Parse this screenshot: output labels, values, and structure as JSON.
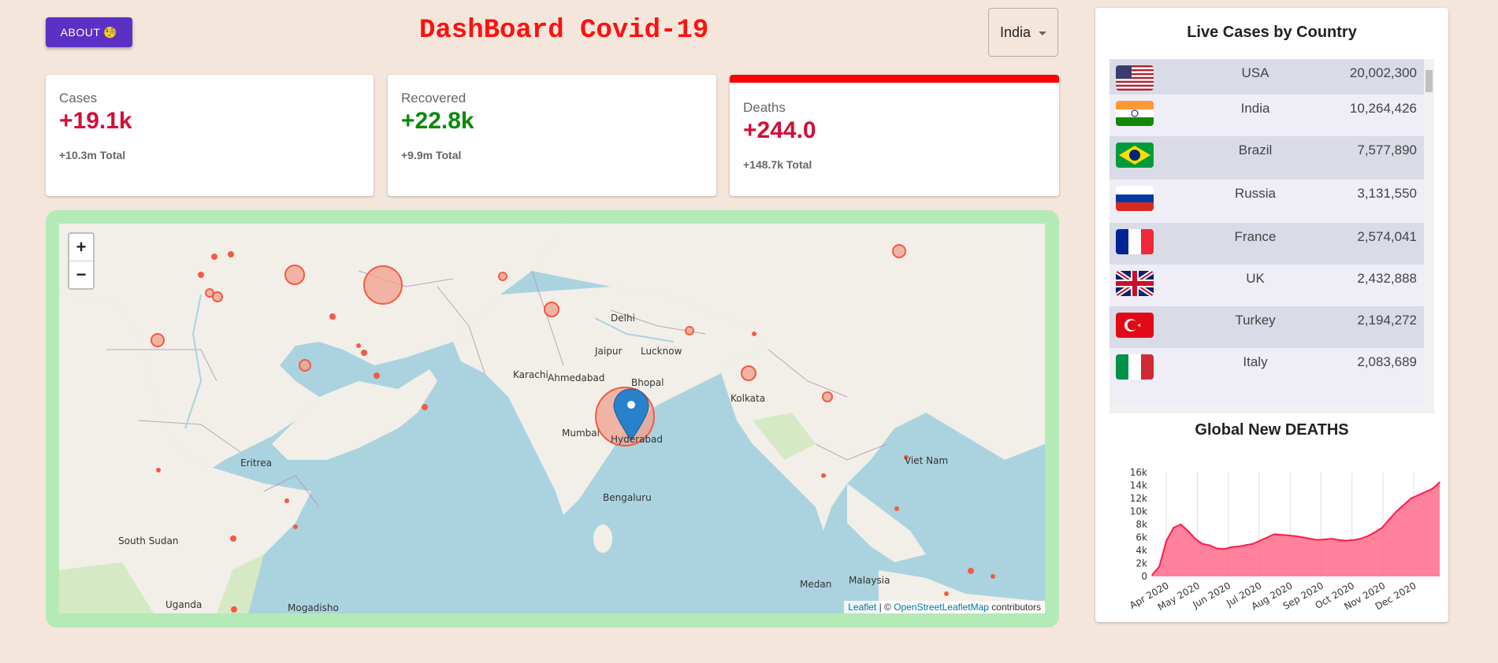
{
  "header": {
    "about_label": "ABOUT",
    "about_emoji": "🧐",
    "title": "DashBoard Covid-19",
    "selected_country": "India"
  },
  "cards": {
    "cases": {
      "label": "Cases",
      "value": "+19.1k",
      "total": "+10.3m Total",
      "color": "#d0103a"
    },
    "recovered": {
      "label": "Recovered",
      "value": "+22.8k",
      "total": "+9.9m Total",
      "color": "#0b8a0b"
    },
    "deaths": {
      "label": "Deaths",
      "value": "+244.0",
      "total": "+148.7k Total",
      "color": "#d0103a"
    }
  },
  "map": {
    "zoom_in": "+",
    "zoom_out": "−",
    "attribution_leaflet": "Leaflet",
    "attribution_sep": " | © ",
    "attribution_osm": "OpenStreetLeafletMap",
    "attribution_suffix": " contributors",
    "labels": [
      "Mumbai",
      "Hyderabad",
      "Bengaluru",
      "Ahmedabad",
      "Bhopal",
      "Jaipur",
      "Delhi",
      "Lucknow",
      "Kolkata",
      "Karachi",
      "Medan",
      "Malaysia",
      "Viet Nam",
      "Eritrea",
      "South Sudan",
      "Uganda",
      "Mogadisho"
    ]
  },
  "panel": {
    "live_title": "Live Cases by Country",
    "countries": [
      {
        "name": "USA",
        "count": "20,002,300",
        "flag": "us-flag"
      },
      {
        "name": "India",
        "count": "10,264,426",
        "flag": "in-flag"
      },
      {
        "name": "Brazil",
        "count": "7,577,890",
        "flag": "br-flag"
      },
      {
        "name": "Russia",
        "count": "3,131,550",
        "flag": "ru-flag"
      },
      {
        "name": "France",
        "count": "2,574,041",
        "flag": "fr-flag"
      },
      {
        "name": "UK",
        "count": "2,432,888",
        "flag": "uk-flag"
      },
      {
        "name": "Turkey",
        "count": "2,194,272",
        "flag": "tr-flag"
      },
      {
        "name": "Italy",
        "count": "2,083,689",
        "flag": "it-flag"
      }
    ],
    "chart_title": "Global New DEATHS"
  },
  "chart_data": {
    "type": "area",
    "title": "Global New DEATHS",
    "x": [
      "Mar 22",
      "Mar 29",
      "Apr 5",
      "Apr 12",
      "Apr 19",
      "Apr 26",
      "May 3",
      "May 10",
      "May 17",
      "May 24",
      "May 31",
      "Jun 7",
      "Jun 14",
      "Jun 21",
      "Jun 28",
      "Jul 5",
      "Jul 12",
      "Jul 19",
      "Jul 26",
      "Aug 2",
      "Aug 9",
      "Aug 16",
      "Aug 23",
      "Aug 30",
      "Sep 6",
      "Sep 13",
      "Sep 20",
      "Sep 27",
      "Oct 4",
      "Oct 11",
      "Oct 18",
      "Oct 25",
      "Nov 1",
      "Nov 8",
      "Nov 15",
      "Nov 22",
      "Nov 29",
      "Dec 6",
      "Dec 13",
      "Dec 20",
      "Dec 27"
    ],
    "values": [
      200,
      1500,
      5500,
      7500,
      8000,
      7000,
      5800,
      5000,
      4800,
      4300,
      4200,
      4500,
      4600,
      4800,
      5000,
      5500,
      6000,
      6500,
      6400,
      6300,
      6200,
      6000,
      5800,
      5600,
      5700,
      5800,
      5600,
      5500,
      5600,
      5800,
      6200,
      6800,
      7500,
      8800,
      10000,
      11000,
      12000,
      12500,
      13000,
      13500,
      14500
    ],
    "xticks": [
      "Apr 2020",
      "May 2020",
      "Jun 2020",
      "Jul 2020",
      "Aug 2020",
      "Sep 2020",
      "Oct 2020",
      "Nov 2020",
      "Dec 2020"
    ],
    "yticks": [
      "0",
      "2k",
      "4k",
      "6k",
      "8k",
      "10k",
      "12k",
      "14k",
      "16k"
    ],
    "ylim": [
      0,
      16000
    ],
    "line_color": "#ff1a4b",
    "fill_color": "#ff6b8a"
  }
}
